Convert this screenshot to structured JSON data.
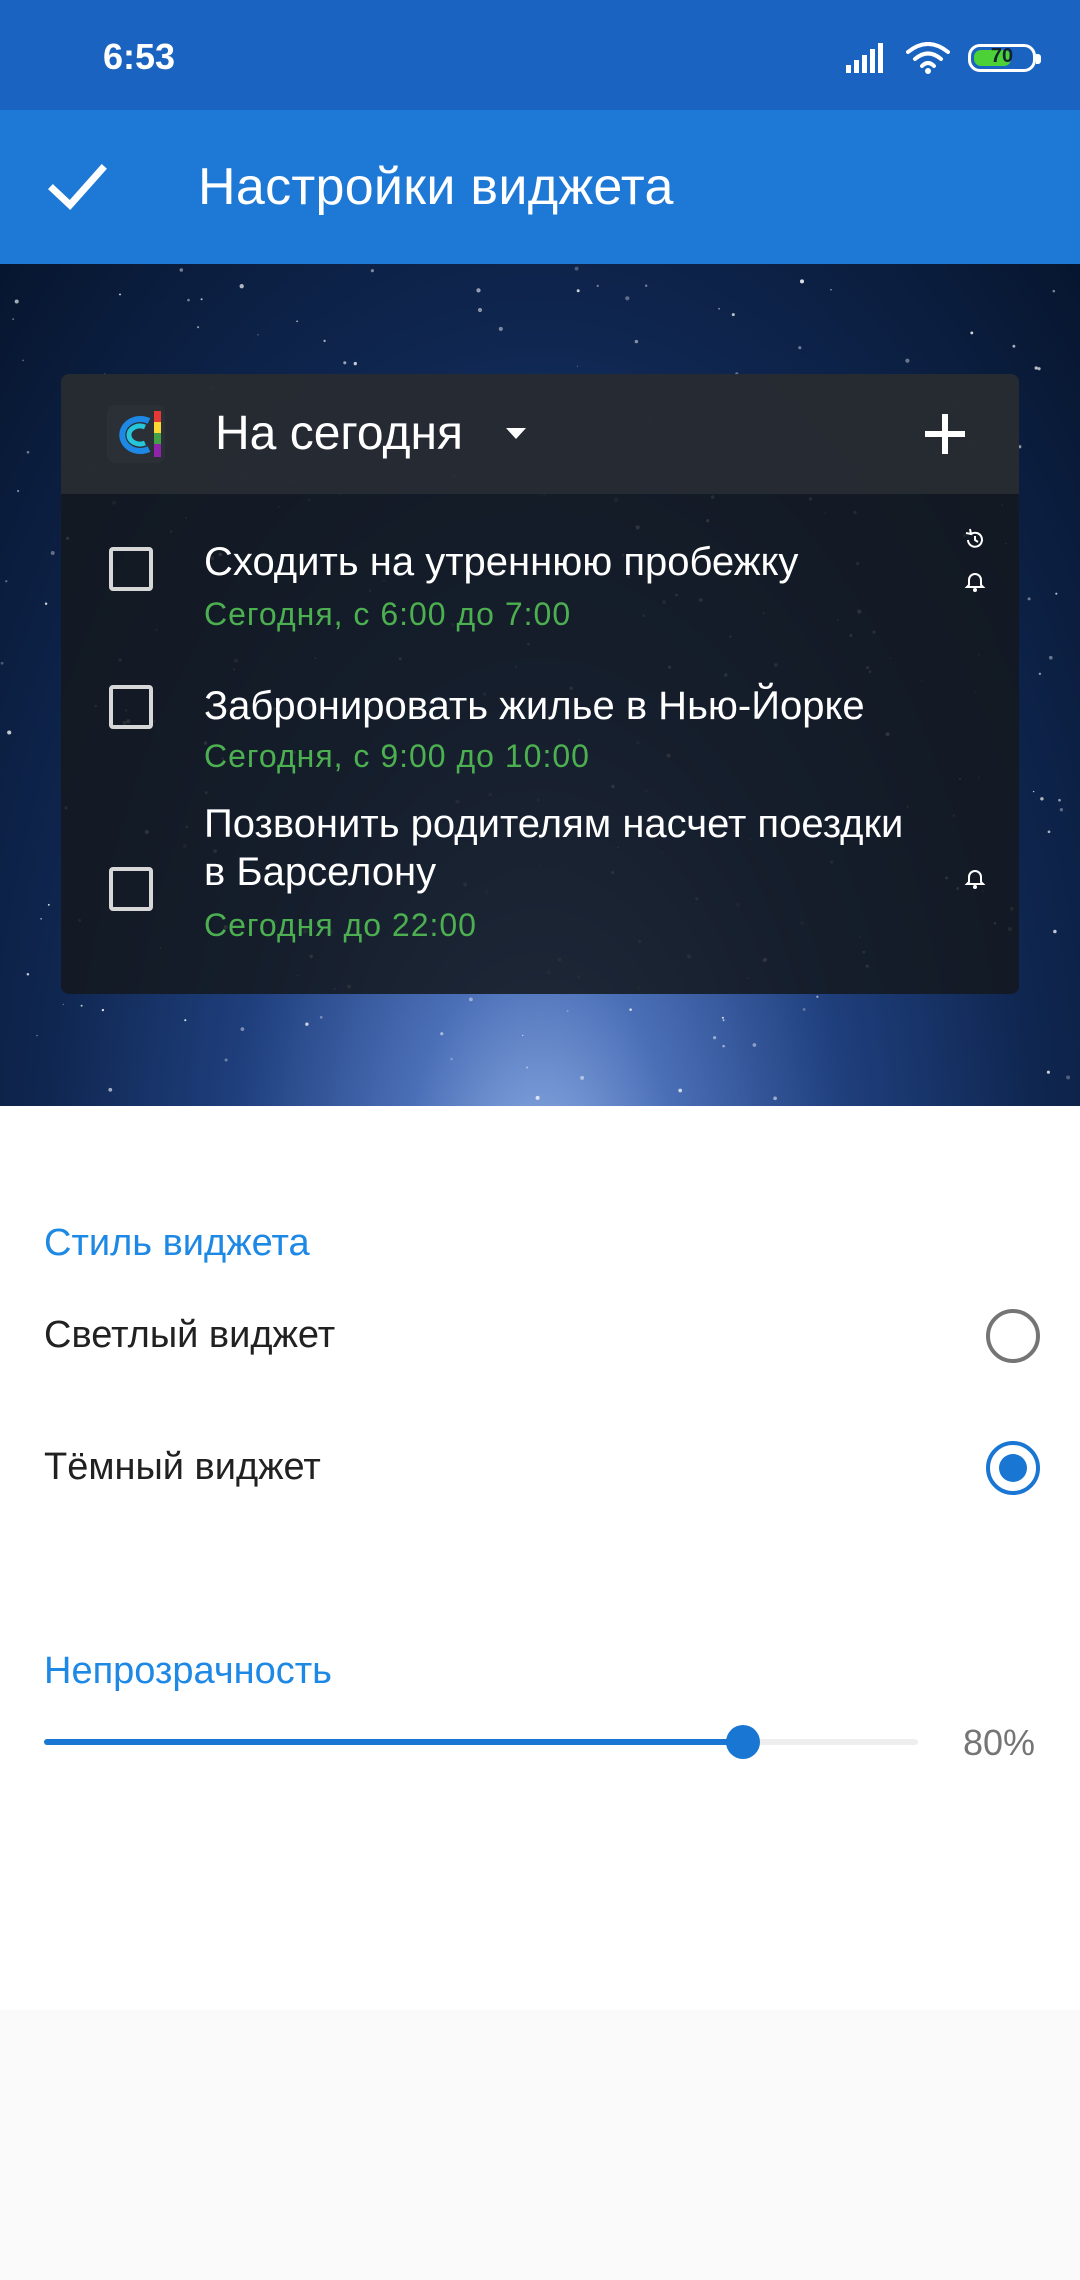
{
  "status_bar": {
    "time": "6:53",
    "battery_percent": "70",
    "battery_level": 0.7
  },
  "app_bar": {
    "title": "Настройки виджета"
  },
  "widget": {
    "list_name": "На сегодня",
    "tasks": [
      {
        "title": "Сходить на утреннюю пробежку",
        "time": "Сегодня, с 6:00 до 7:00",
        "icons": [
          "repeat-icon",
          "bell-icon"
        ]
      },
      {
        "title": "Забронировать жилье в Нью-Йорке",
        "time": "Сегодня, с 9:00 до 10:00",
        "icons": []
      },
      {
        "title_line1": "Позвонить родителям насчет поездки",
        "title_line2": "в Барселону",
        "time": "Сегодня до 22:00",
        "icons": [
          "bell-icon"
        ]
      }
    ]
  },
  "settings": {
    "style_section": "Стиль виджета",
    "light_option": "Светлый виджет",
    "dark_option": "Тёмный виджет",
    "selected_option": "dark",
    "opacity_section": "Непрозрачность",
    "opacity_value": "80%",
    "opacity_fraction": 0.8
  },
  "colors": {
    "app_bar": "#1e78d6",
    "status_bar": "#1a63c0",
    "accent": "#1976d2",
    "task_time": "#4caf50"
  }
}
